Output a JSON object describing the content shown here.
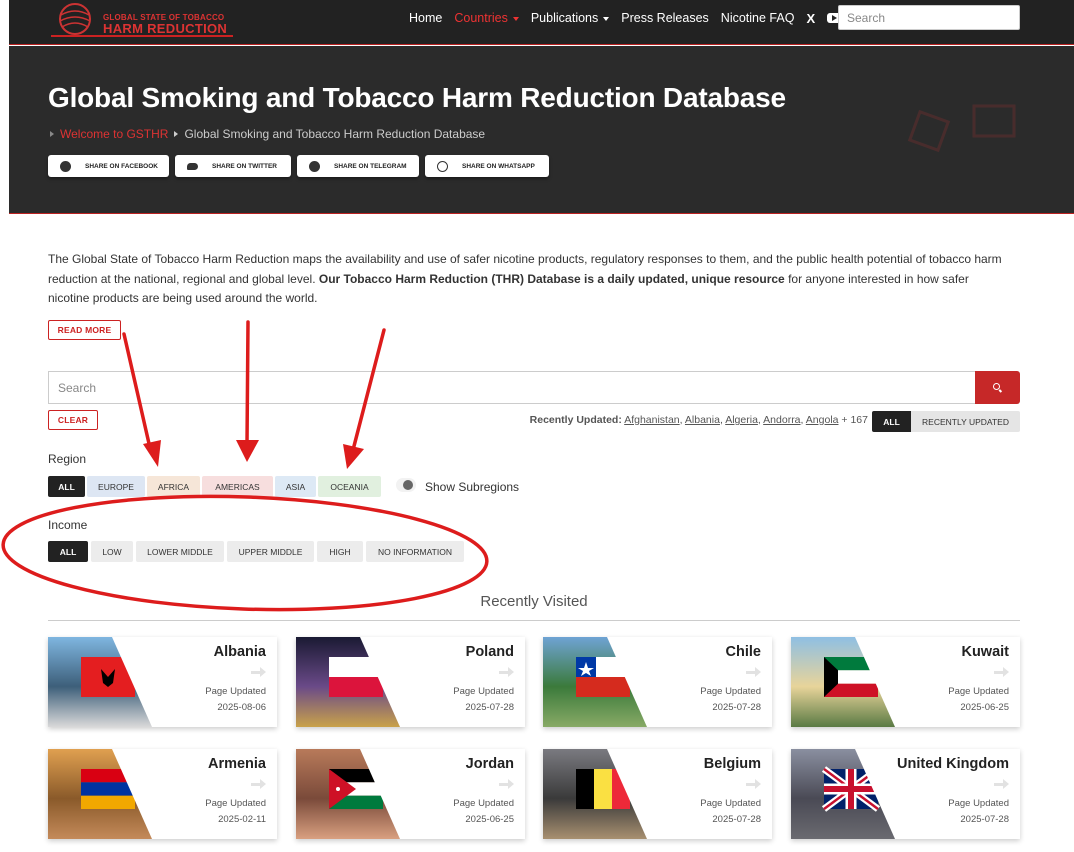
{
  "nav": {
    "logo_line1": "GLOBAL STATE OF TOBACCO",
    "logo_line2": "HARM REDUCTION",
    "links": [
      "Home",
      "Countries",
      "Publications",
      "Press Releases",
      "Nicotine FAQ"
    ],
    "x_icon": "X",
    "search_placeholder": "Search"
  },
  "hero": {
    "title": "Global Smoking and Tobacco Harm Reduction Database",
    "breadcrumb": [
      "Welcome to GSTHR",
      "Global Smoking and Tobacco Harm Reduction Database"
    ],
    "share": [
      "SHARE ON FACEBOOK",
      "SHARE ON TWITTER",
      "SHARE ON TELEGRAM",
      "SHARE ON WHATSAPP"
    ]
  },
  "intro": {
    "part1": "The Global State of Tobacco Harm Reduction maps the availability and use of safer nicotine products, regulatory responses to them, and the public health potential of tobacco harm reduction at the national, regional and global level. ",
    "bold": "Our Tobacco Harm Reduction (THR) Database is a daily updated, unique resource",
    "part2": " for anyone interested in how safer nicotine products are being used around the world.",
    "read_more": "READ MORE"
  },
  "search": {
    "placeholder": "Search",
    "clear": "CLEAR"
  },
  "recently_updated": {
    "label": "Recently Updated:",
    "countries": [
      "Afghanistan",
      "Albania",
      "Algeria",
      "Andorra",
      "Angola"
    ],
    "more": "+ 167",
    "toggle_all": "ALL",
    "toggle_recent": "RECENTLY UPDATED"
  },
  "region": {
    "label": "Region",
    "chips": [
      {
        "label": "ALL",
        "bg": "#222222"
      },
      {
        "label": "EUROPE",
        "bg": "#dde6f3"
      },
      {
        "label": "AFRICA",
        "bg": "#f6e6d8"
      },
      {
        "label": "AMERICAS",
        "bg": "#f7dede"
      },
      {
        "label": "ASIA",
        "bg": "#dde9f5"
      },
      {
        "label": "OCEANIA",
        "bg": "#e1f0df"
      }
    ],
    "subregions": "Show Subregions"
  },
  "income": {
    "label": "Income",
    "chips": [
      "ALL",
      "LOW",
      "LOWER MIDDLE",
      "UPPER MIDDLE",
      "HIGH",
      "NO INFORMATION"
    ]
  },
  "recently_visited": {
    "title": "Recently Visited",
    "page_updated_label": "Page Updated",
    "cards": [
      {
        "name": "Albania",
        "date": "2025-08-06"
      },
      {
        "name": "Poland",
        "date": "2025-07-28"
      },
      {
        "name": "Chile",
        "date": "2025-07-28"
      },
      {
        "name": "Kuwait",
        "date": "2025-06-25"
      },
      {
        "name": "Armenia",
        "date": "2025-02-11"
      },
      {
        "name": "Jordan",
        "date": "2025-06-25"
      },
      {
        "name": "Belgium",
        "date": "2025-07-28"
      },
      {
        "name": "United Kingdom",
        "date": "2025-07-28"
      }
    ]
  },
  "colors": {
    "brand_red": "#c62828",
    "dark": "#222222",
    "annotation_red": "#dd1c1c"
  }
}
